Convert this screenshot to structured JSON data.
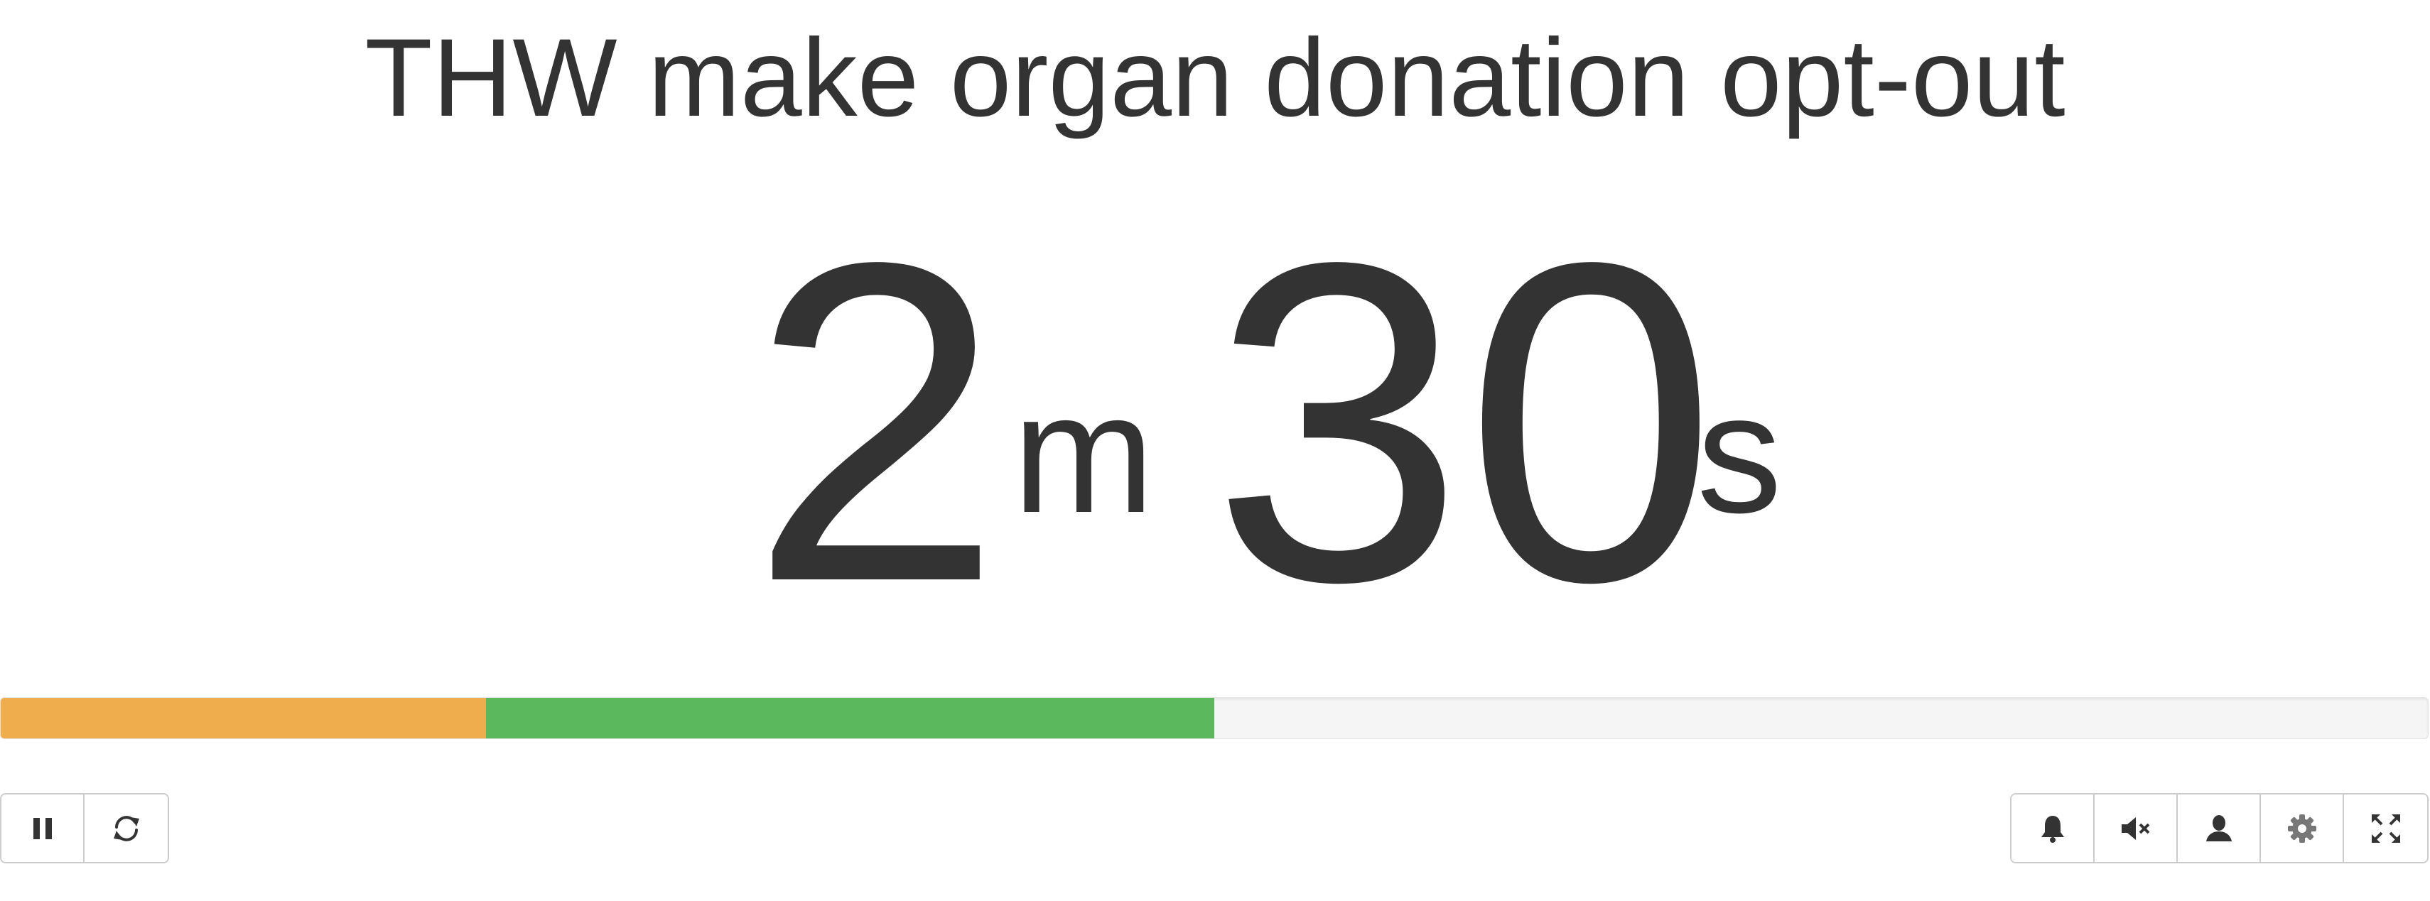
{
  "title": "THW make organ donation opt-out",
  "timer": {
    "minutes": "2",
    "minutes_unit": "m",
    "seconds": "30",
    "seconds_unit": "s"
  },
  "progress": {
    "warning_fraction": 0.2,
    "success_fraction": 0.3,
    "colors": {
      "warning": "#f0ad4e",
      "success": "#5cb85c",
      "track": "#f5f5f5"
    }
  },
  "controls_left": [
    {
      "name": "pause-button",
      "icon": "pause-icon"
    },
    {
      "name": "reset-button",
      "icon": "refresh-icon"
    }
  ],
  "controls_right": [
    {
      "name": "bell-button",
      "icon": "bell-icon"
    },
    {
      "name": "mute-button",
      "icon": "volume-mute-icon"
    },
    {
      "name": "speaker-button",
      "icon": "user-icon"
    },
    {
      "name": "settings-button",
      "icon": "gear-icon"
    },
    {
      "name": "fullscreen-button",
      "icon": "fullscreen-icon"
    }
  ]
}
